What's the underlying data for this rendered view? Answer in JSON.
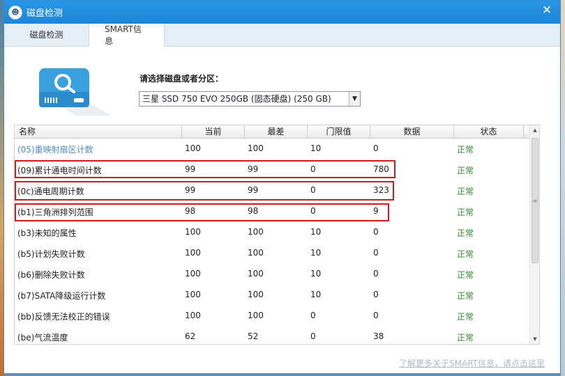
{
  "window": {
    "title": "磁盘检测",
    "close_glyph": "✕"
  },
  "tabs": [
    {
      "label": "磁盘检测",
      "active": false
    },
    {
      "label": "SMART信息",
      "active": true
    }
  ],
  "disk_select": {
    "label": "请选择磁盘或者分区：",
    "value": "三星  SSD 750 EVO 250GB (固态硬盘)  (250 GB)"
  },
  "table": {
    "headers": [
      "名称",
      "当前",
      "最差",
      "门限值",
      "数据",
      "状态"
    ],
    "rows": [
      {
        "name": "(05)重映射扇区计数",
        "current": "100",
        "worst": "100",
        "threshold": "10",
        "data": "0",
        "status": "正常"
      },
      {
        "name": "(09)累计通电时间计数",
        "current": "99",
        "worst": "99",
        "threshold": "0",
        "data": "780",
        "status": "正常"
      },
      {
        "name": "(0c)通电周期计数",
        "current": "99",
        "worst": "99",
        "threshold": "0",
        "data": "323",
        "status": "正常"
      },
      {
        "name": "(b1)三角洲排列范围",
        "current": "98",
        "worst": "98",
        "threshold": "0",
        "data": "9",
        "status": "正常"
      },
      {
        "name": "(b3)未知的属性",
        "current": "100",
        "worst": "100",
        "threshold": "10",
        "data": "0",
        "status": "正常"
      },
      {
        "name": "(b5)计划失败计数",
        "current": "100",
        "worst": "100",
        "threshold": "10",
        "data": "0",
        "status": "正常"
      },
      {
        "name": "(b6)删除失败计数",
        "current": "100",
        "worst": "100",
        "threshold": "10",
        "data": "0",
        "status": "正常"
      },
      {
        "name": "(b7)SATA降级运行计数",
        "current": "100",
        "worst": "100",
        "threshold": "10",
        "data": "0",
        "status": "正常"
      },
      {
        "name": "(bb)反馈无法校正的错误",
        "current": "100",
        "worst": "100",
        "threshold": "0",
        "data": "0",
        "status": "正常"
      },
      {
        "name": "(be)气流温度",
        "current": "62",
        "worst": "52",
        "threshold": "0",
        "data": "38",
        "status": "正常"
      }
    ]
  },
  "footer": {
    "link": "了解更多关于SMART信息，请点击这里"
  },
  "colors": {
    "accent": "#1b85d8",
    "status_ok": "#2d8a2d",
    "highlight": "#d11a1a",
    "link": "#4f8fcf"
  }
}
